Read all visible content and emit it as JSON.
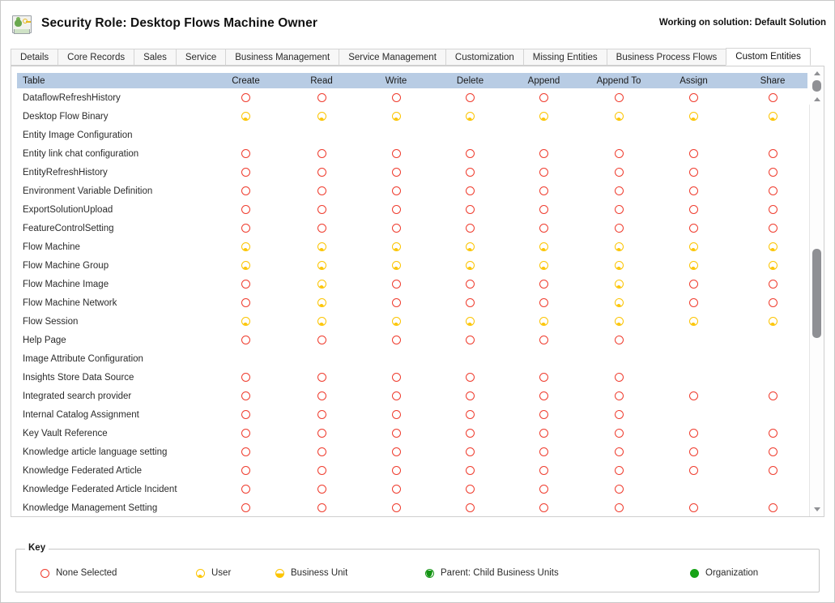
{
  "header": {
    "icon": "security-role-icon",
    "title": "Security Role: Desktop Flows Machine Owner",
    "solution_note": "Working on solution: Default Solution"
  },
  "tabs": [
    {
      "label": "Details",
      "active": false
    },
    {
      "label": "Core Records",
      "active": false
    },
    {
      "label": "Sales",
      "active": false
    },
    {
      "label": "Service",
      "active": false
    },
    {
      "label": "Business Management",
      "active": false
    },
    {
      "label": "Service Management",
      "active": false
    },
    {
      "label": "Customization",
      "active": false
    },
    {
      "label": "Missing Entities",
      "active": false
    },
    {
      "label": "Business Process Flows",
      "active": false
    },
    {
      "label": "Custom Entities",
      "active": true
    }
  ],
  "grid": {
    "columns": [
      "Table",
      "Create",
      "Read",
      "Write",
      "Delete",
      "Append",
      "Append To",
      "Assign",
      "Share"
    ],
    "rows": [
      {
        "name": "DataflowRefreshHistory",
        "perms": [
          "none",
          "none",
          "none",
          "none",
          "none",
          "none",
          "none",
          "none"
        ]
      },
      {
        "name": "Desktop Flow Binary",
        "perms": [
          "user",
          "user",
          "user",
          "user",
          "user",
          "user",
          "user",
          "user"
        ]
      },
      {
        "name": "Entity Image Configuration",
        "perms": [
          "empty",
          "empty",
          "empty",
          "empty",
          "empty",
          "empty",
          "empty",
          "empty"
        ]
      },
      {
        "name": "Entity link chat configuration",
        "perms": [
          "none",
          "none",
          "none",
          "none",
          "none",
          "none",
          "none",
          "none"
        ]
      },
      {
        "name": "EntityRefreshHistory",
        "perms": [
          "none",
          "none",
          "none",
          "none",
          "none",
          "none",
          "none",
          "none"
        ]
      },
      {
        "name": "Environment Variable Definition",
        "perms": [
          "none",
          "none",
          "none",
          "none",
          "none",
          "none",
          "none",
          "none"
        ]
      },
      {
        "name": "ExportSolutionUpload",
        "perms": [
          "none",
          "none",
          "none",
          "none",
          "none",
          "none",
          "none",
          "none"
        ]
      },
      {
        "name": "FeatureControlSetting",
        "perms": [
          "none",
          "none",
          "none",
          "none",
          "none",
          "none",
          "none",
          "none"
        ]
      },
      {
        "name": "Flow Machine",
        "perms": [
          "user",
          "user",
          "user",
          "user",
          "user",
          "user",
          "user",
          "user"
        ]
      },
      {
        "name": "Flow Machine Group",
        "perms": [
          "user",
          "user",
          "user",
          "user",
          "user",
          "user",
          "user",
          "user"
        ]
      },
      {
        "name": "Flow Machine Image",
        "perms": [
          "none",
          "user",
          "none",
          "none",
          "none",
          "user",
          "none",
          "none"
        ]
      },
      {
        "name": "Flow Machine Network",
        "perms": [
          "none",
          "user",
          "none",
          "none",
          "none",
          "user",
          "none",
          "none"
        ]
      },
      {
        "name": "Flow Session",
        "perms": [
          "user",
          "user",
          "user",
          "user",
          "user",
          "user",
          "user",
          "user"
        ]
      },
      {
        "name": "Help Page",
        "perms": [
          "none",
          "none",
          "none",
          "none",
          "none",
          "none",
          "empty",
          "empty"
        ]
      },
      {
        "name": "Image Attribute Configuration",
        "perms": [
          "empty",
          "empty",
          "empty",
          "empty",
          "empty",
          "empty",
          "empty",
          "empty"
        ]
      },
      {
        "name": "Insights Store Data Source",
        "perms": [
          "none",
          "none",
          "none",
          "none",
          "none",
          "none",
          "empty",
          "empty"
        ]
      },
      {
        "name": "Integrated search provider",
        "perms": [
          "none",
          "none",
          "none",
          "none",
          "none",
          "none",
          "none",
          "none"
        ]
      },
      {
        "name": "Internal Catalog Assignment",
        "perms": [
          "none",
          "none",
          "none",
          "none",
          "none",
          "none",
          "empty",
          "empty"
        ]
      },
      {
        "name": "Key Vault Reference",
        "perms": [
          "none",
          "none",
          "none",
          "none",
          "none",
          "none",
          "none",
          "none"
        ]
      },
      {
        "name": "Knowledge article language setting",
        "perms": [
          "none",
          "none",
          "none",
          "none",
          "none",
          "none",
          "none",
          "none"
        ]
      },
      {
        "name": "Knowledge Federated Article",
        "perms": [
          "none",
          "none",
          "none",
          "none",
          "none",
          "none",
          "none",
          "none"
        ]
      },
      {
        "name": "Knowledge Federated Article Incident",
        "perms": [
          "none",
          "none",
          "none",
          "none",
          "none",
          "none",
          "empty",
          "empty"
        ]
      },
      {
        "name": "Knowledge Management Setting",
        "perms": [
          "none",
          "none",
          "none",
          "none",
          "none",
          "none",
          "none",
          "none"
        ]
      }
    ]
  },
  "key": {
    "title": "Key",
    "items": [
      {
        "glyph": "none",
        "label": "None Selected"
      },
      {
        "glyph": "user",
        "label": "User"
      },
      {
        "glyph": "bu",
        "label": "Business Unit"
      },
      {
        "glyph": "parent",
        "label": "Parent: Child Business Units"
      },
      {
        "glyph": "org",
        "label": "Organization"
      }
    ]
  },
  "colors": {
    "none_selected": "#ef3b2d",
    "user": "#fcc400",
    "business_unit": "#fcc400",
    "parent_child": "#149414",
    "organization": "#17a317",
    "header_band": "#b8cce4"
  }
}
